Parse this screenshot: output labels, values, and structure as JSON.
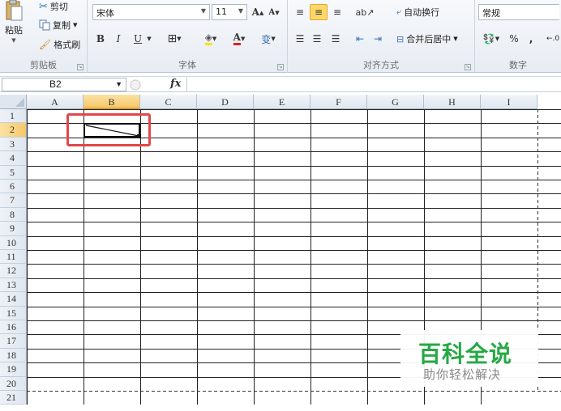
{
  "clipboard": {
    "paste_label": "粘贴",
    "cut_label": "剪切",
    "copy_label": "复制",
    "format_painter_label": "格式刷",
    "group_label": "剪贴板"
  },
  "font": {
    "name": "宋体",
    "size": "11",
    "bold_label": "B",
    "italic_label": "I",
    "underline_label": "U",
    "grow_label": "A",
    "shrink_label": "A",
    "wen_label": "变",
    "group_label": "字体"
  },
  "alignment": {
    "wrap_label": "自动换行",
    "merge_label": "合并后居中",
    "group_label": "对齐方式"
  },
  "number": {
    "format": "常规",
    "percent_label": "%",
    "comma_label": ",",
    "group_label": "数字"
  },
  "formula_bar": {
    "name_box": "B2",
    "fx_label": "fx",
    "formula": ""
  },
  "sheet": {
    "columns": [
      "A",
      "B",
      "C",
      "D",
      "E",
      "F",
      "G",
      "H",
      "I"
    ],
    "rows": [
      "1",
      "2",
      "3",
      "4",
      "5",
      "6",
      "7",
      "8",
      "9",
      "10",
      "11",
      "12",
      "13",
      "14",
      "15",
      "16",
      "17",
      "18",
      "19",
      "20",
      "21"
    ],
    "active_cell": "B2",
    "highlight_color": "#e0484a"
  },
  "watermark": {
    "title": "百科全说",
    "subtitle": "助你轻松解决"
  }
}
